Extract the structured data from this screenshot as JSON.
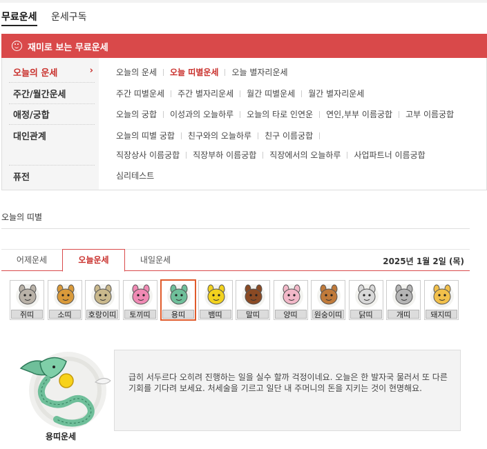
{
  "top_tabs": [
    {
      "label": "무료운세",
      "active": true
    },
    {
      "label": "운세구독",
      "active": false
    }
  ],
  "header": {
    "title": "재미로 보는 무료운세"
  },
  "left_menu": [
    {
      "label": "오늘의 운세",
      "active": true
    },
    {
      "label": "주간/월간운세",
      "active": false
    },
    {
      "label": "애정/궁합",
      "active": false
    },
    {
      "label": "대인관계",
      "active": false
    },
    {
      "label": "퓨전",
      "active": false
    }
  ],
  "right_menu": {
    "row1": [
      "오늘의 운세",
      "오늘 띠별운세",
      "오늘 별자리운세"
    ],
    "row2": [
      "주간 띠별운세",
      "주간 별자리운세",
      "월간 띠별운세",
      "월간 별자리운세"
    ],
    "row3": [
      "오늘의 궁합",
      "이성과의 오늘하루",
      "오늘의 타로 인연운",
      "연인,부부 이름궁합",
      "고부 이름궁합"
    ],
    "row4": [
      "오늘의 띠별 궁합",
      "친구와의 오늘하루",
      "친구 이름궁합"
    ],
    "row5": [
      "직장상사 이름궁합",
      "직장부하 이름궁합",
      "직장에서의 오늘하루",
      "사업파트너 이름궁합"
    ],
    "row6": [
      "심리테스트"
    ],
    "active_item": "오늘 띠별운세"
  },
  "section_title": "오늘의 띠별",
  "day_tabs": [
    {
      "label": "어제운세",
      "active": false
    },
    {
      "label": "오늘운세",
      "active": true
    },
    {
      "label": "내일운세",
      "active": false
    }
  ],
  "date": "2025년 1월 2일 (목)",
  "zodiac": [
    {
      "label": "쥐띠",
      "icon": "rat-icon",
      "color": "#b9b2a8"
    },
    {
      "label": "소띠",
      "icon": "ox-icon",
      "color": "#d99a3a"
    },
    {
      "label": "호랑이띠",
      "icon": "tiger-icon",
      "color": "#c9b88c"
    },
    {
      "label": "토끼띠",
      "icon": "rabbit-icon",
      "color": "#f08ab4"
    },
    {
      "label": "용띠",
      "icon": "dragon-icon",
      "color": "#6fbf9a"
    },
    {
      "label": "뱀띠",
      "icon": "snake-icon",
      "color": "#f2d21e"
    },
    {
      "label": "말띠",
      "icon": "horse-icon",
      "color": "#8a4a24"
    },
    {
      "label": "양띠",
      "icon": "sheep-icon",
      "color": "#f2b8c8"
    },
    {
      "label": "원숭이띠",
      "icon": "monkey-icon",
      "color": "#c07a3a"
    },
    {
      "label": "닭띠",
      "icon": "rooster-icon",
      "color": "#d8d8d8"
    },
    {
      "label": "개띠",
      "icon": "dog-icon",
      "color": "#b5b5b5"
    },
    {
      "label": "돼지띠",
      "icon": "pig-icon",
      "color": "#f2c04a"
    }
  ],
  "selected_zodiac": "용띠",
  "fortune": {
    "title": "용띠운세",
    "text": "급히 서두르다 오히려 진행하는 일을 실수 할까 걱정이네요. 오늘은 한 발자국 물러서 또 다른 기회를 기다려 보세요. 처세술을 기르고 일단 내 주머니의 돈을 지키는 것이 현명해요."
  },
  "colors": {
    "accent": "#d9494a",
    "active_text": "#c9302c",
    "selected_border": "#e05a2a"
  }
}
